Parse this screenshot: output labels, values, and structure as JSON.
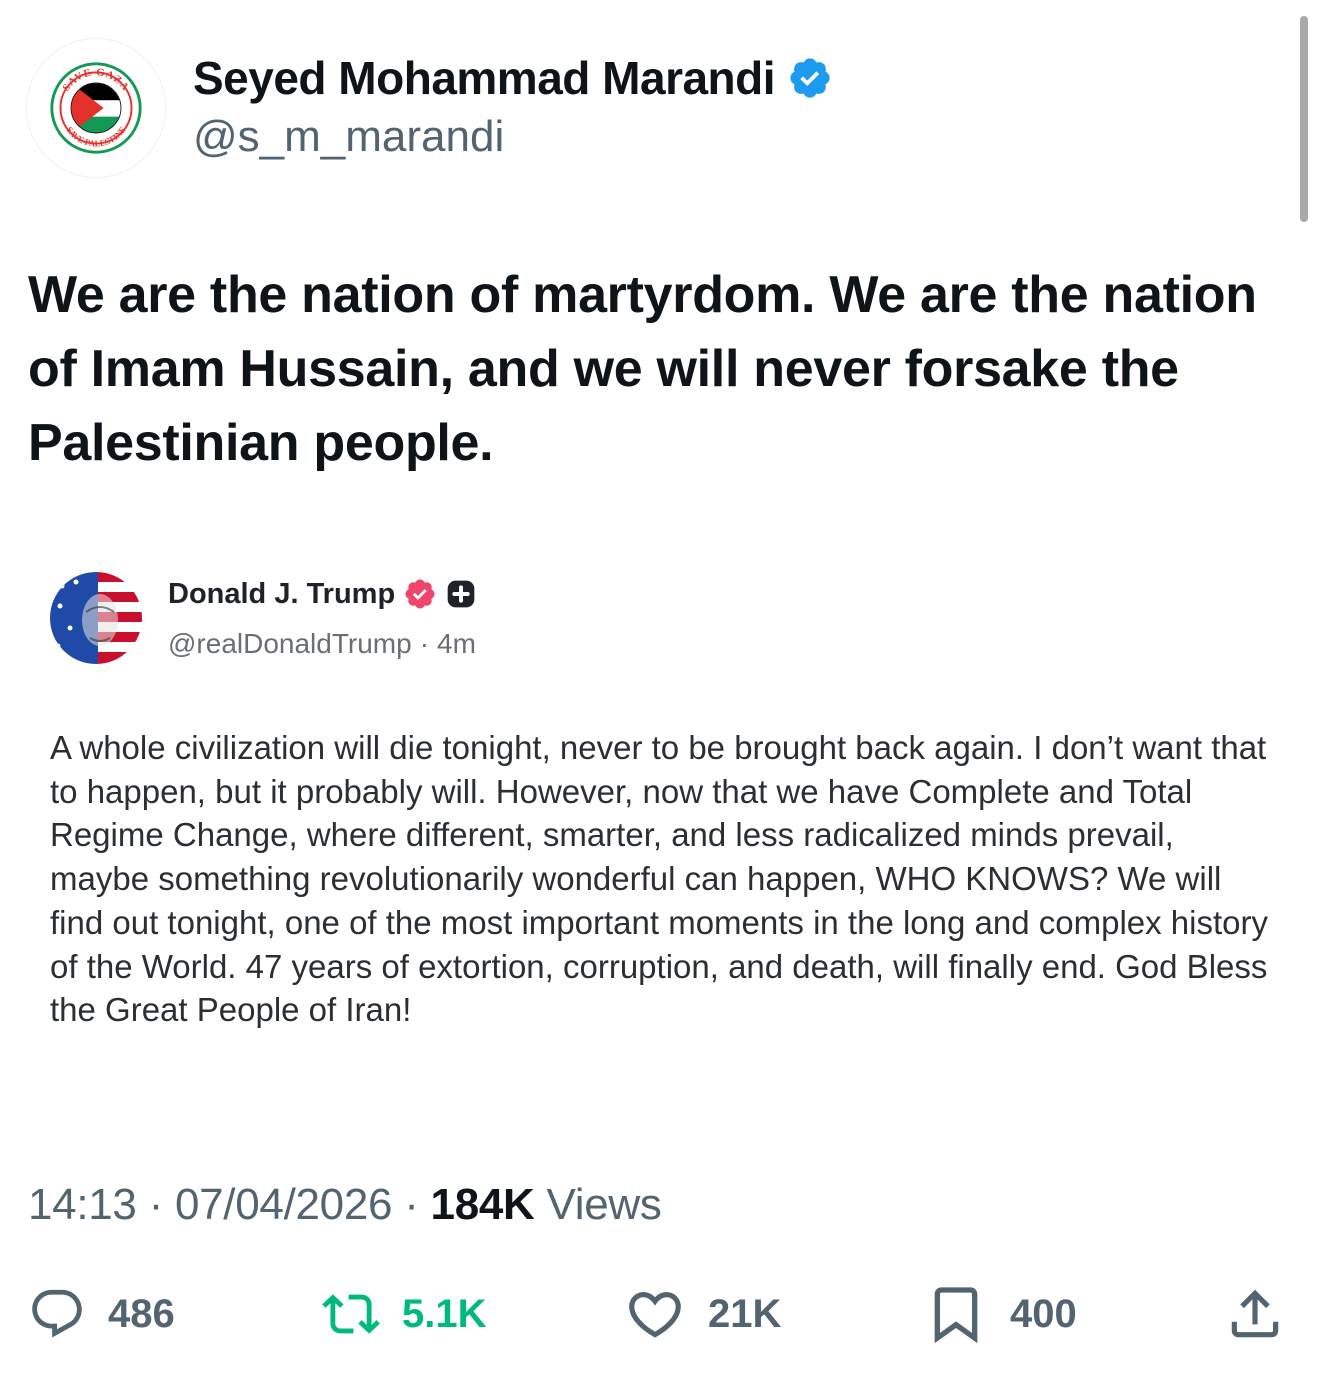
{
  "author": {
    "name": "Seyed Mohammad Marandi",
    "handle": "@s_m_marandi",
    "avatar_top_text": "SAVE GAZA",
    "avatar_bottom_text": "SAVE PALESTINE",
    "verified_color": "#1d9bf0"
  },
  "tweet": {
    "text": "We are the nation of martyrdom. We are the nation of Imam Hussain, and we will never forsake the Palestinian people."
  },
  "embedded": {
    "name": "Donald J. Trump",
    "handle": "@realDonaldTrump",
    "separator": "·",
    "time": "4m",
    "badge_color": "#f0466e",
    "text": "A whole civilization will die tonight, never to be brought back again. I don’t want that to happen, but it probably will. However, now that we have Complete and Total Regime Change, where different, smarter, and less radicalized minds prevail, maybe something revolutionarily wonderful can happen, WHO KNOWS? We will find out tonight, one of the most important moments in the long and complex history of the World. 47 years of extortion, corruption, and death, will finally end. God Bless the Great People of Iran!"
  },
  "meta": {
    "time": "14:13",
    "sep1": "·",
    "date": "07/04/2026",
    "sep2": "·",
    "views_count": "184K",
    "views_label": "Views"
  },
  "actions": {
    "replies": "486",
    "reposts": "5.1K",
    "likes": "21K",
    "bookmarks": "400"
  },
  "colors": {
    "text_primary": "#0f1419",
    "text_secondary": "#536471",
    "repost_green": "#00ba7c",
    "palestine_red": "#e4312b",
    "palestine_green": "#149954"
  }
}
